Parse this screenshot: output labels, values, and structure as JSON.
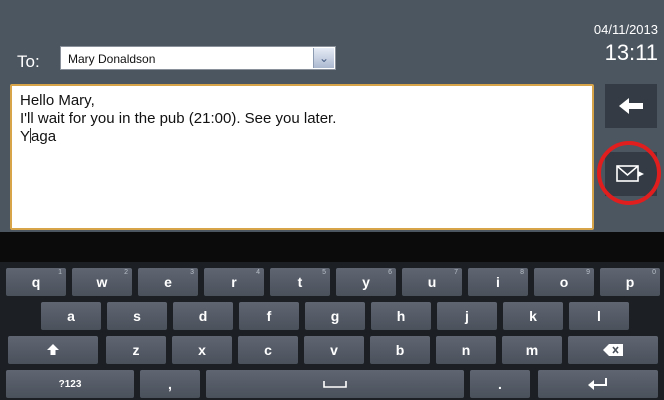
{
  "header": {
    "to_label": "To:",
    "recipient": "Mary Donaldson",
    "date": "04/11/2013",
    "time": "13:11"
  },
  "message": {
    "lines": [
      "Hello Mary,",
      "I'll wait for you in the pub (21:00). See you later.",
      "Y",
      "aga"
    ]
  },
  "icons": {
    "back": "left-arrow-icon",
    "send": "envelope-send-icon",
    "dropdown": "chevron-down-icon"
  },
  "colors": {
    "highlight_ring": "#e01e1e",
    "textarea_border": "#d7a44a"
  },
  "keyboard": {
    "row1": [
      {
        "k": "q",
        "h": "1"
      },
      {
        "k": "w",
        "h": "2"
      },
      {
        "k": "e",
        "h": "3"
      },
      {
        "k": "r",
        "h": "4"
      },
      {
        "k": "t",
        "h": "5"
      },
      {
        "k": "y",
        "h": "6"
      },
      {
        "k": "u",
        "h": "7"
      },
      {
        "k": "i",
        "h": "8"
      },
      {
        "k": "o",
        "h": "9"
      },
      {
        "k": "p",
        "h": "0"
      }
    ],
    "row2": [
      "a",
      "s",
      "d",
      "f",
      "g",
      "h",
      "j",
      "k",
      "l"
    ],
    "row3": [
      "z",
      "x",
      "c",
      "v",
      "b",
      "n",
      "m"
    ],
    "row4": {
      "symbols": "?123",
      "comma": ",",
      "period": "."
    }
  }
}
